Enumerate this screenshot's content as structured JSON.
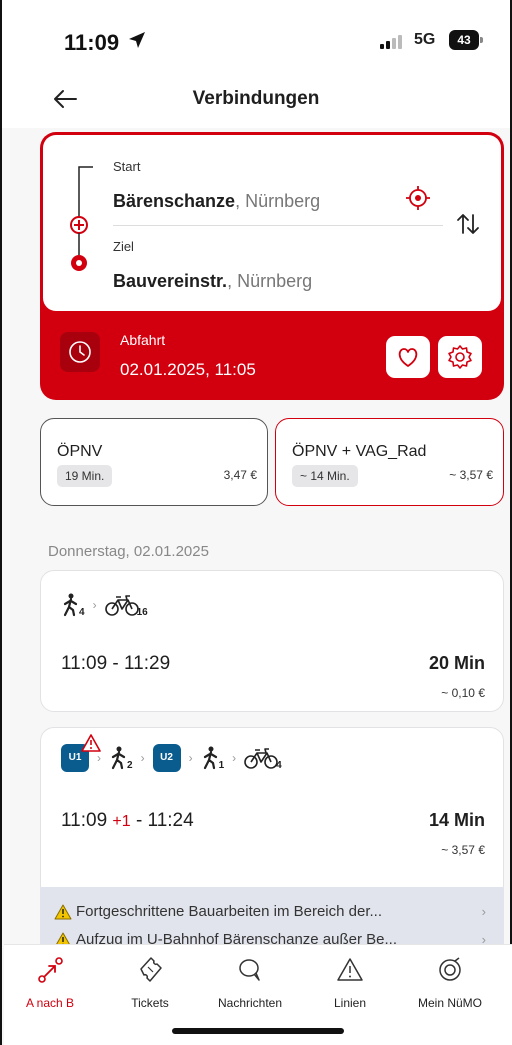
{
  "status": {
    "time": "11:09",
    "network": "5G",
    "battery": "43"
  },
  "nav": {
    "title": "Verbindungen"
  },
  "route": {
    "start_label": "Start",
    "start_name": "Bärenschanze",
    "start_city": ", Nürnberg",
    "dest_label": "Ziel",
    "dest_name": "Bauvereinstr.",
    "dest_city": ", Nürnberg",
    "departure_label": "Abfahrt",
    "departure_value": "02.01.2025, 11:05"
  },
  "modes": [
    {
      "name": "ÖPNV",
      "duration": "19 Min.",
      "price": "3,47 €"
    },
    {
      "name": "ÖPNV + VAG_Rad",
      "duration": "~ 14 Min.",
      "price": "~ 3,57 €"
    }
  ],
  "date_header": "Donnerstag, 02.01.2025",
  "connections": [
    {
      "walk_min": "4",
      "bike_min": "16",
      "time": "11:09 - 11:29",
      "duration": "20 Min",
      "price": "~ 0,10 €"
    },
    {
      "line1": "U1",
      "walk1_min": "2",
      "line2": "U2",
      "walk2_min": "1",
      "bike_min": "4",
      "time_start": "11:09",
      "delay": "+1",
      "time_end": " - 11:24",
      "duration": "14 Min",
      "price": "~ 3,57 €",
      "alerts": [
        "Fortgeschrittene Bauarbeiten im Bereich der...",
        "Aufzug im U-Bahnhof Bärenschanze außer Be..."
      ]
    }
  ],
  "tabs": [
    {
      "label": "A nach B",
      "active": true
    },
    {
      "label": "Tickets"
    },
    {
      "label": "Nachrichten"
    },
    {
      "label": "Linien"
    },
    {
      "label": "Mein NüMO"
    }
  ],
  "colors": {
    "accent": "#d2000f",
    "ubahn": "#0b5c8e"
  }
}
